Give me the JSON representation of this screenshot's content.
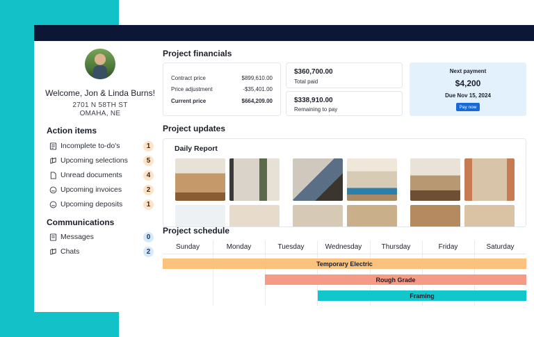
{
  "sidebar": {
    "welcome": "Welcome, Jon & Linda Burns!",
    "address_line1": "2701 N 58TH ST",
    "address_line2": "OMAHA, NE",
    "action_items_title": "Action items",
    "action_items": [
      {
        "label": "Incomplete to-do's",
        "count": "1",
        "icon": "checklist-icon"
      },
      {
        "label": "Upcoming selections",
        "count": "5",
        "icon": "selection-icon"
      },
      {
        "label": "Unread documents",
        "count": "4",
        "icon": "document-icon"
      },
      {
        "label": "Upcoming invoices",
        "count": "2",
        "icon": "invoice-icon"
      },
      {
        "label": "Upcoming deposits",
        "count": "1",
        "icon": "deposit-icon"
      }
    ],
    "communications_title": "Communications",
    "communications": [
      {
        "label": "Messages",
        "count": "0",
        "icon": "message-icon"
      },
      {
        "label": "Chats",
        "count": "2",
        "icon": "chat-icon"
      }
    ]
  },
  "financials": {
    "title": "Project financials",
    "contract_label": "Contract price",
    "contract_value": "$899,610.00",
    "adjust_label": "Price adjustment",
    "adjust_value": "-$35,401.00",
    "current_label": "Current price",
    "current_value": "$664,209.00",
    "total_paid_value": "$360,700.00",
    "total_paid_label": "Total paid",
    "remaining_value": "$338,910.00",
    "remaining_label": "Remaining to pay",
    "next_title": "Next payment",
    "next_amount": "$4,200",
    "next_due": "Due Nov 15, 2024",
    "pay_button": "Pay now"
  },
  "updates": {
    "title": "Project updates",
    "report_title": "Daily Report"
  },
  "schedule": {
    "title": "Project schedule",
    "days": [
      "Sunday",
      "Monday",
      "Tuesday",
      "Wednesday",
      "Thursday",
      "Friday",
      "Saturday"
    ],
    "tasks": [
      {
        "name": "Temporary Electric",
        "color": "#fbc27e"
      },
      {
        "name": "Rough Grade",
        "color": "#f49a86"
      },
      {
        "name": "Framing",
        "color": "#12c7cc"
      }
    ]
  },
  "colors": {
    "accent": "#13c1c9",
    "topbar": "#0b1735",
    "button": "#1868d8"
  }
}
